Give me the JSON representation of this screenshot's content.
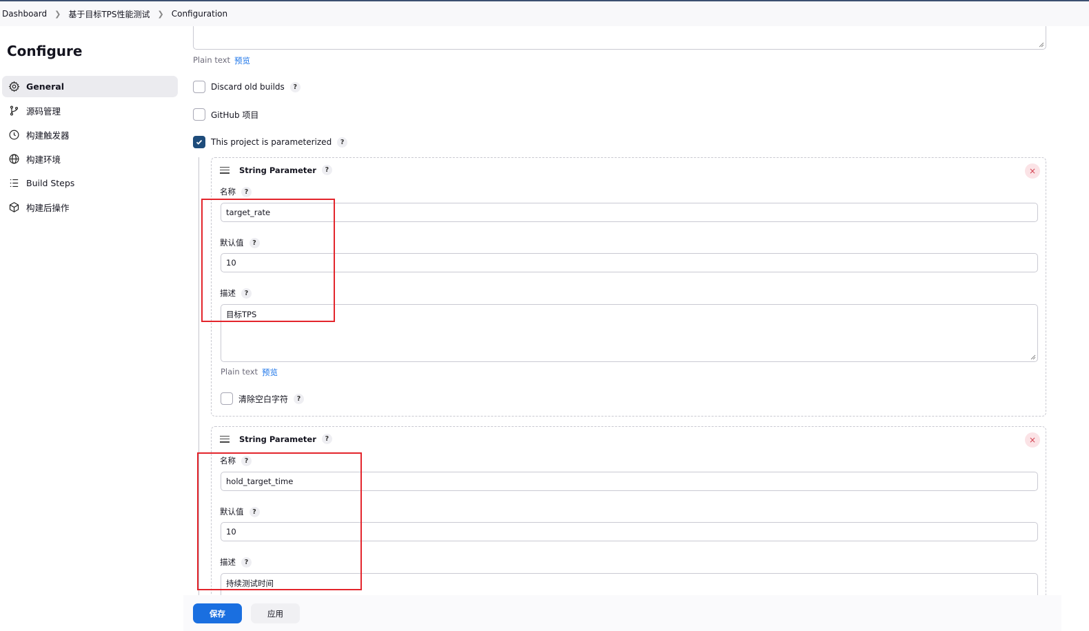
{
  "breadcrumb": [
    "Dashboard",
    "基于目标TPS性能测试",
    "Configuration"
  ],
  "page_title": "Configure",
  "sidebar": {
    "items": [
      {
        "label": "General",
        "icon": "gear-icon",
        "active": true
      },
      {
        "label": "源码管理",
        "icon": "branch-icon",
        "active": false
      },
      {
        "label": "构建触发器",
        "icon": "clock-icon",
        "active": false
      },
      {
        "label": "构建环境",
        "icon": "globe-icon",
        "active": false
      },
      {
        "label": "Build Steps",
        "icon": "list-icon",
        "active": false
      },
      {
        "label": "构建后操作",
        "icon": "cube-icon",
        "active": false
      }
    ]
  },
  "description_hint": {
    "text": "Plain text",
    "link": "预览"
  },
  "options": {
    "discard_old_builds": {
      "label": "Discard old builds",
      "checked": false
    },
    "github_project": {
      "label": "GitHub 项目",
      "checked": false
    },
    "parameterized": {
      "label": "This project is parameterized",
      "checked": true
    }
  },
  "help_label": "?",
  "params": [
    {
      "type_label": "String Parameter",
      "name_label": "名称",
      "name_value": "target_rate",
      "default_label": "默认值",
      "default_value": "10",
      "desc_label": "描述",
      "desc_value": "目标TPS",
      "hint_text": "Plain text",
      "hint_link": "预览",
      "trim_label": "清除空白字符"
    },
    {
      "type_label": "String Parameter",
      "name_label": "名称",
      "name_value": "hold_target_time",
      "default_label": "默认值",
      "default_value": "10",
      "desc_label": "描述",
      "desc_value": "持续测试时间"
    }
  ],
  "close_symbol": "×",
  "buttons": {
    "save": "保存",
    "apply": "应用"
  },
  "colors": {
    "primary": "#1a6fe0",
    "checked": "#1e4c7b",
    "highlight": "#e3242b"
  }
}
